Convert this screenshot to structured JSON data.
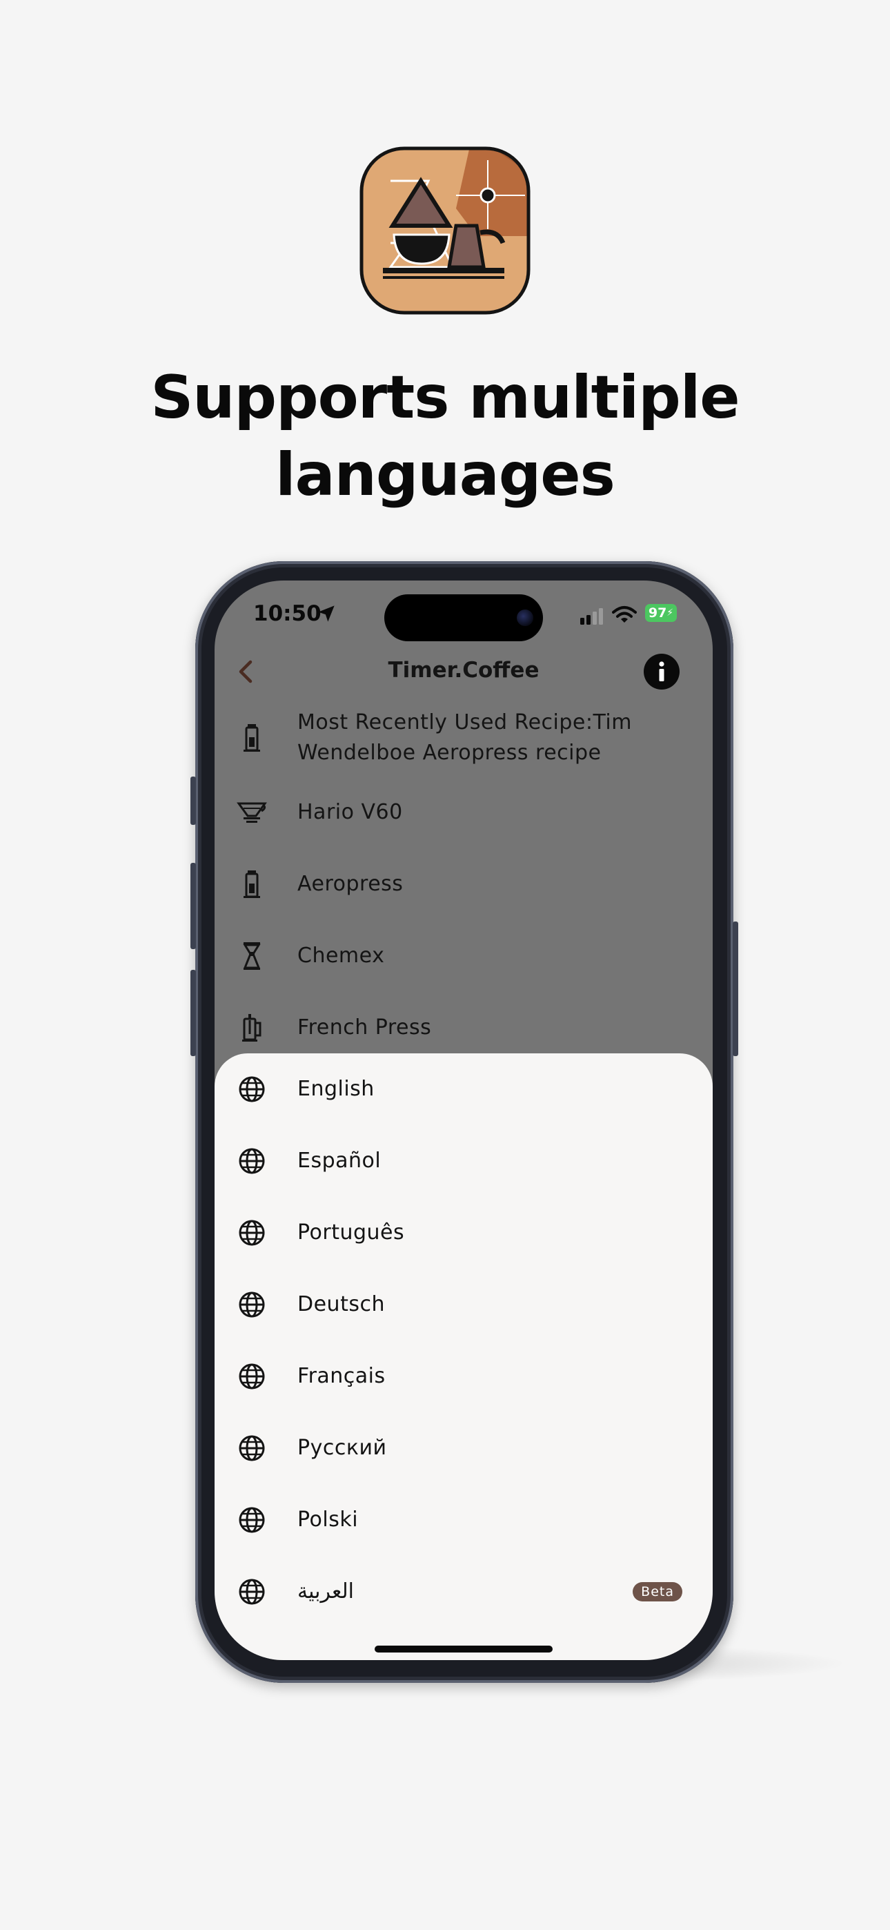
{
  "headline": {
    "line1": "Supports multiple",
    "line2": "languages"
  },
  "status_bar": {
    "time": "10:50",
    "battery": "97",
    "icons": [
      "location-arrow-icon",
      "signal-icon",
      "wifi-icon"
    ]
  },
  "app_bar": {
    "title": "Timer.Coffee",
    "back_icon": "chevron-left-icon",
    "info_icon": "info-icon"
  },
  "menu": {
    "items": [
      {
        "label": "Most Recently Used Recipe:Tim Wendelboe Aeropress recipe",
        "line1": "Most Recently Used Recipe:Tim",
        "line2": "Wendelboe Aeropress recipe",
        "icon": "aeropress-icon"
      },
      {
        "label": "Hario V60",
        "icon": "v60-dripper-icon"
      },
      {
        "label": "Aeropress",
        "icon": "aeropress-icon"
      },
      {
        "label": "Chemex",
        "icon": "chemex-icon"
      },
      {
        "label": "French Press",
        "icon": "french-press-icon"
      }
    ]
  },
  "language_sheet": {
    "items": [
      {
        "label": "English",
        "icon": "globe-icon"
      },
      {
        "label": "Español",
        "icon": "globe-icon"
      },
      {
        "label": "Português",
        "icon": "globe-icon"
      },
      {
        "label": "Deutsch",
        "icon": "globe-icon"
      },
      {
        "label": "Français",
        "icon": "globe-icon"
      },
      {
        "label": "Русский",
        "icon": "globe-icon"
      },
      {
        "label": "Polski",
        "icon": "globe-icon"
      },
      {
        "label": "العربية",
        "icon": "globe-icon",
        "badge": "Beta"
      }
    ]
  },
  "colors": {
    "background": "#f5f5f5",
    "overlay": "#757575",
    "sheet": "#f7f6f5",
    "beta_badge": "#6e5349",
    "battery": "#4cc760",
    "icon_tan": "#dfa874",
    "icon_brown": "#b86b3d"
  }
}
